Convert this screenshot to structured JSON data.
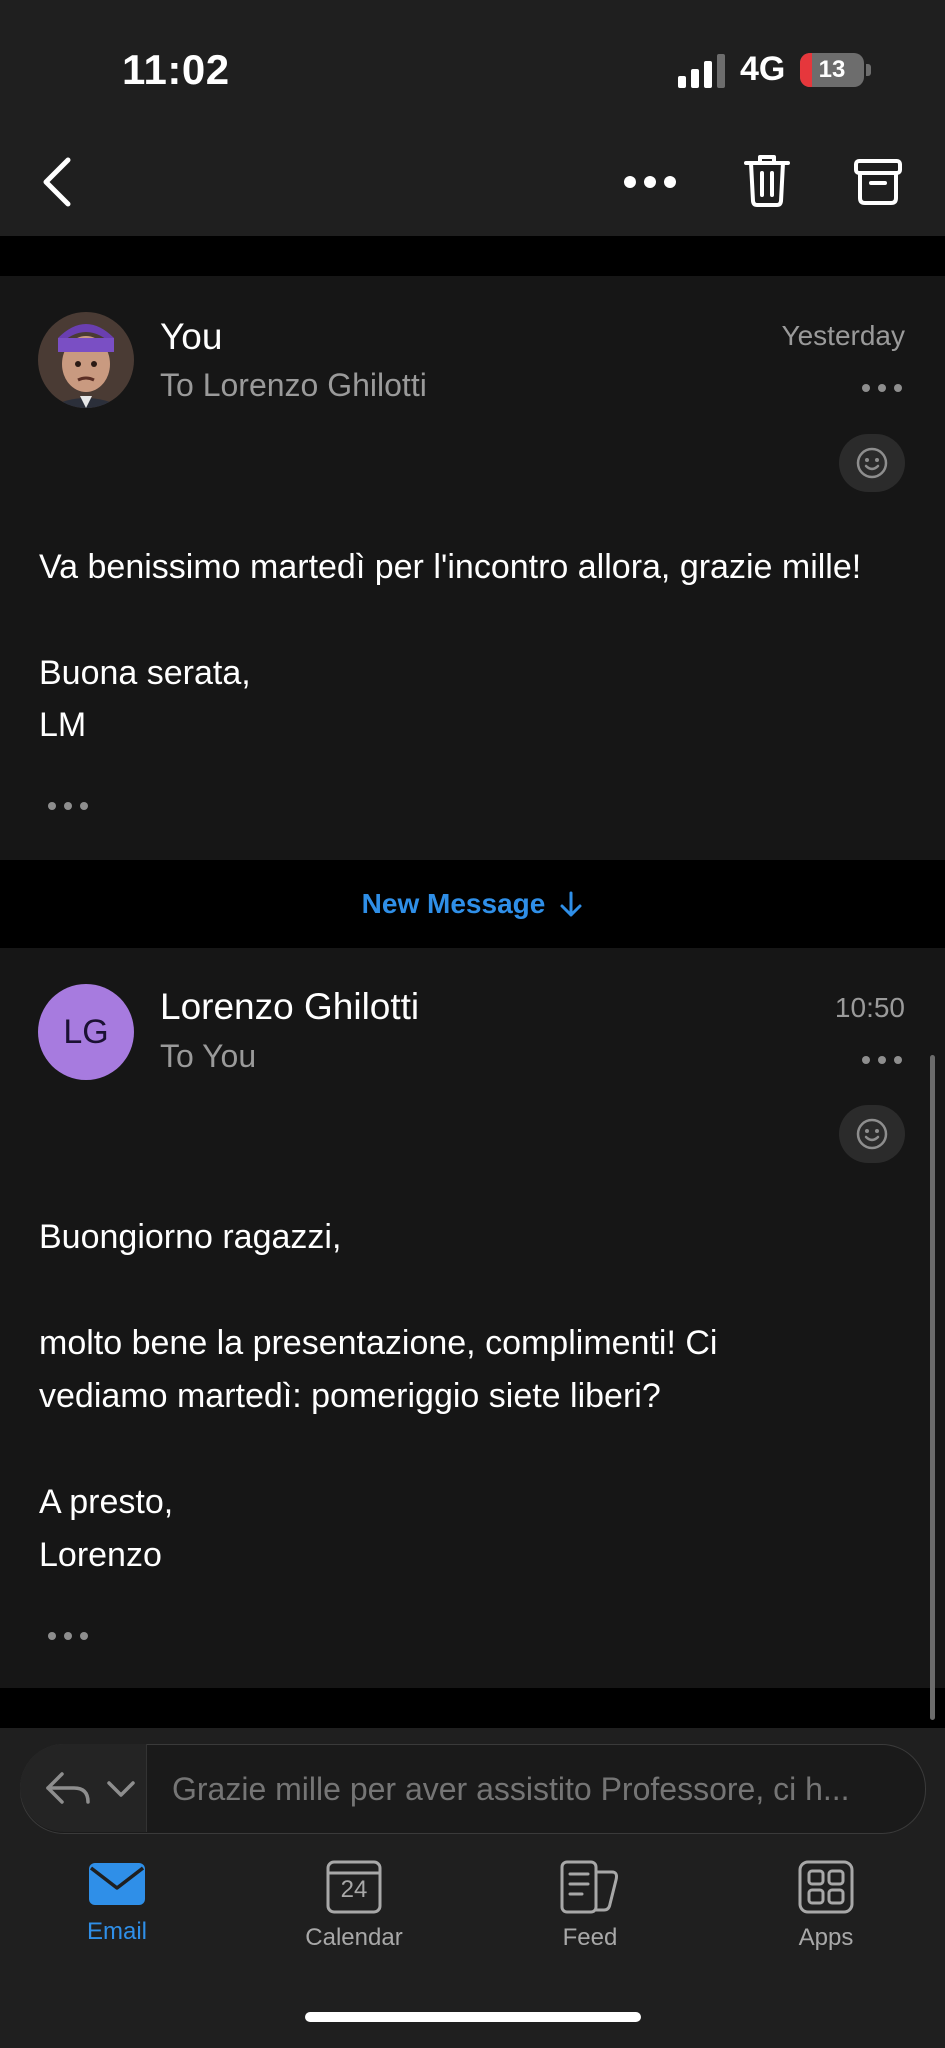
{
  "status_bar": {
    "time": "11:02",
    "network": "4G",
    "battery": "13"
  },
  "messages": [
    {
      "sender": "You",
      "recipient": "To Lorenzo Ghilotti",
      "time": "Yesterday",
      "avatar_type": "photo",
      "body": [
        "Va benissimo martedì per l'incontro allora, grazie mille!",
        "",
        "Buona serata,",
        "LM"
      ]
    },
    {
      "sender": "Lorenzo Ghilotti",
      "recipient": "To You",
      "time": "10:50",
      "avatar_initials": "LG",
      "body": [
        "Buongiorno ragazzi,",
        "",
        "molto bene la presentazione, complimenti! Ci",
        "vediamo martedì: pomeriggio siete liberi?",
        "",
        "A presto,",
        "Lorenzo"
      ]
    }
  ],
  "divider": {
    "label": "New Message"
  },
  "reply": {
    "placeholder": "Grazie mille per aver assistito Professore, ci h..."
  },
  "tabs": [
    {
      "label": "Email",
      "icon": "mail-icon",
      "active": true
    },
    {
      "label": "Calendar",
      "icon": "calendar-icon",
      "day": "24"
    },
    {
      "label": "Feed",
      "icon": "feed-icon"
    },
    {
      "label": "Apps",
      "icon": "apps-grid-icon"
    }
  ],
  "colors": {
    "accent": "#2f8fe8",
    "initials_avatar": "#a77bdf",
    "card_bg": "#161616",
    "bar_bg": "#1f1f1f"
  }
}
